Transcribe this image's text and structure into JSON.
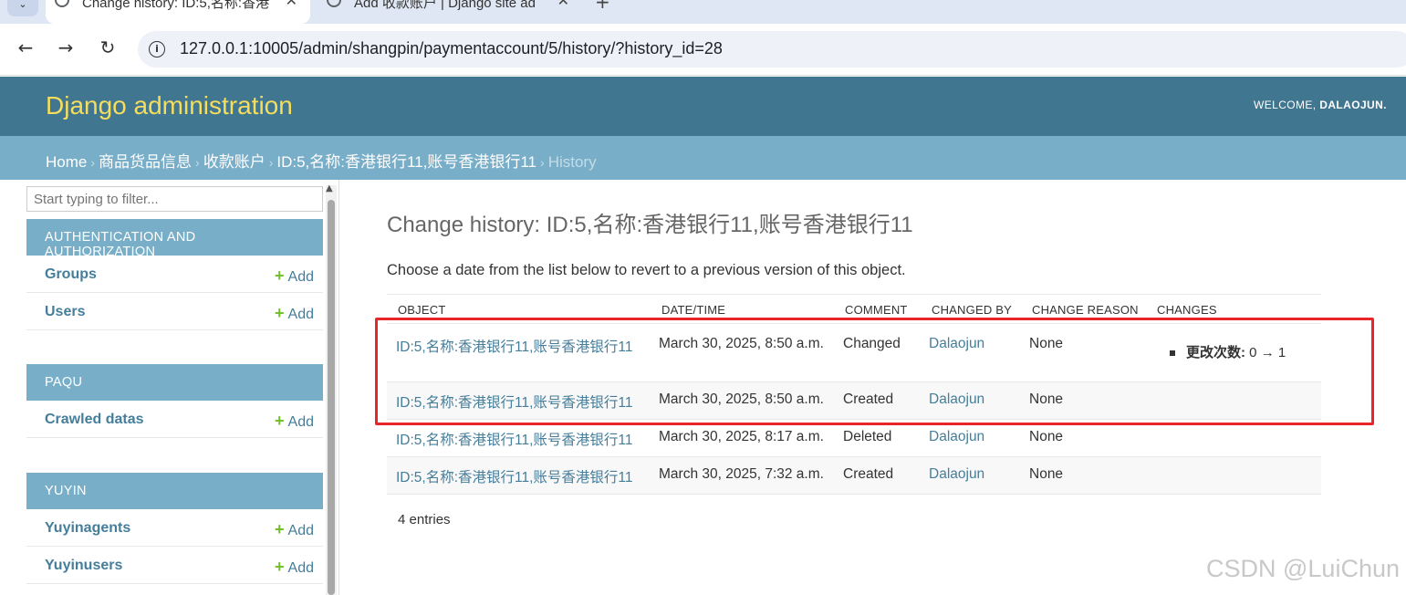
{
  "browser": {
    "tabs": [
      {
        "label": "Change history: ID:5,名称:香港",
        "active": true
      },
      {
        "label": "Add 收款账户 | Django site ad",
        "active": false
      }
    ],
    "url": "127.0.0.1:10005/admin/shangpin/paymentaccount/5/history/?history_id=28"
  },
  "header": {
    "branding": "Django administration",
    "welcome": "WELCOME,",
    "username": "DALAOJUN."
  },
  "breadcrumbs": {
    "home": "Home",
    "app": "商品货品信息",
    "model": "收款账户",
    "object": "ID:5,名称:香港银行11,账号香港银行11",
    "current": "History"
  },
  "sidebar": {
    "filter_placeholder": "Start typing to filter...",
    "add_label": "Add",
    "modules": [
      {
        "caption": "AUTHENTICATION AND AUTHORIZATION",
        "items": [
          "Groups",
          "Users"
        ]
      },
      {
        "caption": "PAQU",
        "items": [
          "Crawled datas"
        ]
      },
      {
        "caption": "YUYIN",
        "items": [
          "Yuyinagents",
          "Yuyinusers"
        ]
      }
    ]
  },
  "content": {
    "title": "Change history: ID:5,名称:香港银行11,账号香港银行11",
    "intro": "Choose a date from the list below to revert to a previous version of this object.",
    "columns": [
      "OBJECT",
      "DATE/TIME",
      "COMMENT",
      "CHANGED BY",
      "CHANGE REASON",
      "CHANGES"
    ],
    "rows": [
      {
        "object": "ID:5,名称:香港银行11,账号香港银行11",
        "datetime": "March 30, 2025, 8:50 a.m.",
        "comment": "Changed",
        "changed_by": "Dalaojun",
        "reason": "None",
        "change_field": "更改次数:",
        "change_from": "0",
        "arrow": "→",
        "change_to": "1"
      },
      {
        "object": "ID:5,名称:香港银行11,账号香港银行11",
        "datetime": "March 30, 2025, 8:50 a.m.",
        "comment": "Created",
        "changed_by": "Dalaojun",
        "reason": "None"
      },
      {
        "object": "ID:5,名称:香港银行11,账号香港银行11",
        "datetime": "March 30, 2025, 8:17 a.m.",
        "comment": "Deleted",
        "changed_by": "Dalaojun",
        "reason": "None"
      },
      {
        "object": "ID:5,名称:香港银行11,账号香港银行11",
        "datetime": "March 30, 2025, 7:32 a.m.",
        "comment": "Created",
        "changed_by": "Dalaojun",
        "reason": "None"
      }
    ],
    "entries": "4 entries"
  },
  "watermark": "CSDN @LuiChun",
  "colors": {
    "header_bg": "#417690",
    "branding": "#f5dd5d",
    "breadcrumbs_bg": "#79aec8",
    "link": "#447e9b",
    "add_plus": "#70bf2b",
    "highlight": "#e8262a"
  }
}
